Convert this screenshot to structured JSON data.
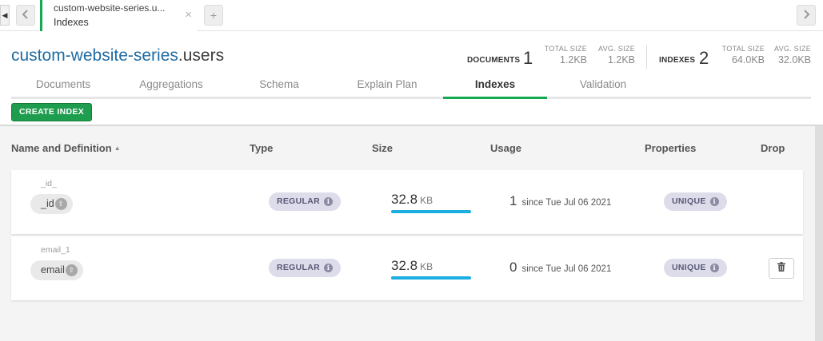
{
  "tab": {
    "title": "custom-website-series.u...",
    "subtitle": "Indexes",
    "close_icon": "close-icon",
    "add_icon": "plus-icon"
  },
  "header": {
    "db": "custom-website-series",
    "collection": ".users",
    "documents": {
      "label": "DOCUMENTS",
      "count": "1",
      "total_size_label": "TOTAL SIZE",
      "total_size": "1.2KB",
      "avg_size_label": "AVG. SIZE",
      "avg_size": "1.2KB"
    },
    "indexes": {
      "label": "INDEXES",
      "count": "2",
      "total_size_label": "TOTAL SIZE",
      "total_size": "64.0KB",
      "avg_size_label": "AVG. SIZE",
      "avg_size": "32.0KB"
    }
  },
  "subtabs": [
    {
      "label": "Documents"
    },
    {
      "label": "Aggregations"
    },
    {
      "label": "Schema"
    },
    {
      "label": "Explain Plan"
    },
    {
      "label": "Indexes",
      "active": true
    },
    {
      "label": "Validation"
    }
  ],
  "toolbar": {
    "create_label": "CREATE INDEX"
  },
  "table": {
    "headers": [
      "Name and Definition",
      "Type",
      "Size",
      "Usage",
      "Properties",
      "Drop"
    ],
    "rows": [
      {
        "name": "_id_",
        "field": "_id",
        "type": "REGULAR",
        "size": "32.8",
        "unit": "KB",
        "size_fill": 1.0,
        "usage": "1",
        "since": "since Tue Jul 06 2021",
        "property": "UNIQUE",
        "droppable": false
      },
      {
        "name": "email_1",
        "field": "email",
        "type": "REGULAR",
        "size": "32.8",
        "unit": "KB",
        "size_fill": 1.0,
        "usage": "0",
        "since": "since Tue Jul 06 2021",
        "property": "UNIQUE",
        "droppable": true
      }
    ]
  },
  "colors": {
    "accent": "#13aa52",
    "db_link": "#1f6ca4",
    "size_bar": "#1aaee2",
    "button": "#1f9d4f"
  }
}
